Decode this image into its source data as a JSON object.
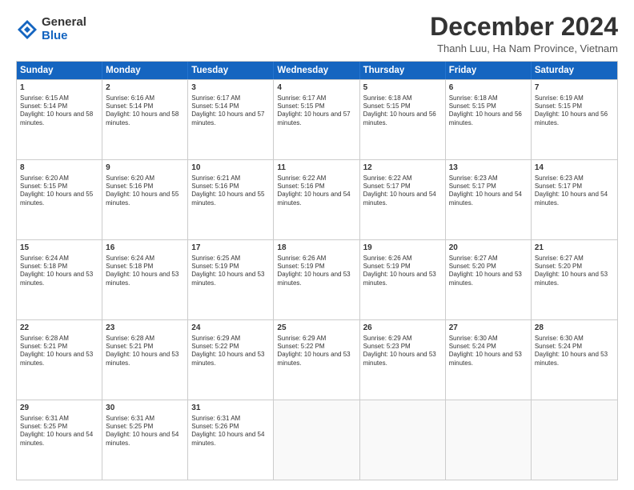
{
  "logo": {
    "general": "General",
    "blue": "Blue"
  },
  "title": "December 2024",
  "location": "Thanh Luu, Ha Nam Province, Vietnam",
  "days": [
    "Sunday",
    "Monday",
    "Tuesday",
    "Wednesday",
    "Thursday",
    "Friday",
    "Saturday"
  ],
  "weeks": [
    [
      {
        "day": "1",
        "sunrise": "Sunrise: 6:15 AM",
        "sunset": "Sunset: 5:14 PM",
        "daylight": "Daylight: 10 hours and 58 minutes."
      },
      {
        "day": "2",
        "sunrise": "Sunrise: 6:16 AM",
        "sunset": "Sunset: 5:14 PM",
        "daylight": "Daylight: 10 hours and 58 minutes."
      },
      {
        "day": "3",
        "sunrise": "Sunrise: 6:17 AM",
        "sunset": "Sunset: 5:14 PM",
        "daylight": "Daylight: 10 hours and 57 minutes."
      },
      {
        "day": "4",
        "sunrise": "Sunrise: 6:17 AM",
        "sunset": "Sunset: 5:15 PM",
        "daylight": "Daylight: 10 hours and 57 minutes."
      },
      {
        "day": "5",
        "sunrise": "Sunrise: 6:18 AM",
        "sunset": "Sunset: 5:15 PM",
        "daylight": "Daylight: 10 hours and 56 minutes."
      },
      {
        "day": "6",
        "sunrise": "Sunrise: 6:18 AM",
        "sunset": "Sunset: 5:15 PM",
        "daylight": "Daylight: 10 hours and 56 minutes."
      },
      {
        "day": "7",
        "sunrise": "Sunrise: 6:19 AM",
        "sunset": "Sunset: 5:15 PM",
        "daylight": "Daylight: 10 hours and 56 minutes."
      }
    ],
    [
      {
        "day": "8",
        "sunrise": "Sunrise: 6:20 AM",
        "sunset": "Sunset: 5:15 PM",
        "daylight": "Daylight: 10 hours and 55 minutes."
      },
      {
        "day": "9",
        "sunrise": "Sunrise: 6:20 AM",
        "sunset": "Sunset: 5:16 PM",
        "daylight": "Daylight: 10 hours and 55 minutes."
      },
      {
        "day": "10",
        "sunrise": "Sunrise: 6:21 AM",
        "sunset": "Sunset: 5:16 PM",
        "daylight": "Daylight: 10 hours and 55 minutes."
      },
      {
        "day": "11",
        "sunrise": "Sunrise: 6:22 AM",
        "sunset": "Sunset: 5:16 PM",
        "daylight": "Daylight: 10 hours and 54 minutes."
      },
      {
        "day": "12",
        "sunrise": "Sunrise: 6:22 AM",
        "sunset": "Sunset: 5:17 PM",
        "daylight": "Daylight: 10 hours and 54 minutes."
      },
      {
        "day": "13",
        "sunrise": "Sunrise: 6:23 AM",
        "sunset": "Sunset: 5:17 PM",
        "daylight": "Daylight: 10 hours and 54 minutes."
      },
      {
        "day": "14",
        "sunrise": "Sunrise: 6:23 AM",
        "sunset": "Sunset: 5:17 PM",
        "daylight": "Daylight: 10 hours and 54 minutes."
      }
    ],
    [
      {
        "day": "15",
        "sunrise": "Sunrise: 6:24 AM",
        "sunset": "Sunset: 5:18 PM",
        "daylight": "Daylight: 10 hours and 53 minutes."
      },
      {
        "day": "16",
        "sunrise": "Sunrise: 6:24 AM",
        "sunset": "Sunset: 5:18 PM",
        "daylight": "Daylight: 10 hours and 53 minutes."
      },
      {
        "day": "17",
        "sunrise": "Sunrise: 6:25 AM",
        "sunset": "Sunset: 5:19 PM",
        "daylight": "Daylight: 10 hours and 53 minutes."
      },
      {
        "day": "18",
        "sunrise": "Sunrise: 6:26 AM",
        "sunset": "Sunset: 5:19 PM",
        "daylight": "Daylight: 10 hours and 53 minutes."
      },
      {
        "day": "19",
        "sunrise": "Sunrise: 6:26 AM",
        "sunset": "Sunset: 5:19 PM",
        "daylight": "Daylight: 10 hours and 53 minutes."
      },
      {
        "day": "20",
        "sunrise": "Sunrise: 6:27 AM",
        "sunset": "Sunset: 5:20 PM",
        "daylight": "Daylight: 10 hours and 53 minutes."
      },
      {
        "day": "21",
        "sunrise": "Sunrise: 6:27 AM",
        "sunset": "Sunset: 5:20 PM",
        "daylight": "Daylight: 10 hours and 53 minutes."
      }
    ],
    [
      {
        "day": "22",
        "sunrise": "Sunrise: 6:28 AM",
        "sunset": "Sunset: 5:21 PM",
        "daylight": "Daylight: 10 hours and 53 minutes."
      },
      {
        "day": "23",
        "sunrise": "Sunrise: 6:28 AM",
        "sunset": "Sunset: 5:21 PM",
        "daylight": "Daylight: 10 hours and 53 minutes."
      },
      {
        "day": "24",
        "sunrise": "Sunrise: 6:29 AM",
        "sunset": "Sunset: 5:22 PM",
        "daylight": "Daylight: 10 hours and 53 minutes."
      },
      {
        "day": "25",
        "sunrise": "Sunrise: 6:29 AM",
        "sunset": "Sunset: 5:22 PM",
        "daylight": "Daylight: 10 hours and 53 minutes."
      },
      {
        "day": "26",
        "sunrise": "Sunrise: 6:29 AM",
        "sunset": "Sunset: 5:23 PM",
        "daylight": "Daylight: 10 hours and 53 minutes."
      },
      {
        "day": "27",
        "sunrise": "Sunrise: 6:30 AM",
        "sunset": "Sunset: 5:24 PM",
        "daylight": "Daylight: 10 hours and 53 minutes."
      },
      {
        "day": "28",
        "sunrise": "Sunrise: 6:30 AM",
        "sunset": "Sunset: 5:24 PM",
        "daylight": "Daylight: 10 hours and 53 minutes."
      }
    ],
    [
      {
        "day": "29",
        "sunrise": "Sunrise: 6:31 AM",
        "sunset": "Sunset: 5:25 PM",
        "daylight": "Daylight: 10 hours and 54 minutes."
      },
      {
        "day": "30",
        "sunrise": "Sunrise: 6:31 AM",
        "sunset": "Sunset: 5:25 PM",
        "daylight": "Daylight: 10 hours and 54 minutes."
      },
      {
        "day": "31",
        "sunrise": "Sunrise: 6:31 AM",
        "sunset": "Sunset: 5:26 PM",
        "daylight": "Daylight: 10 hours and 54 minutes."
      },
      null,
      null,
      null,
      null
    ]
  ]
}
